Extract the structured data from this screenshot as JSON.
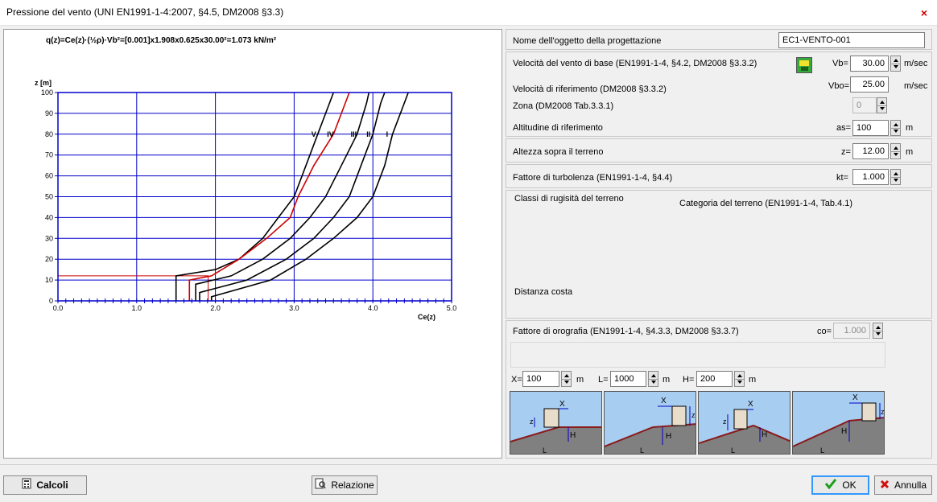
{
  "window": {
    "title": "Pressione del vento (UNI EN1991-1-4:2007, §4.5, DM2008 §3.3)",
    "close_glyph": "×"
  },
  "chart": {
    "formula": "q(z)=Ce(z)·(½ρ)·Vb²=[0.001]x1.908x0.625x30.00²=1.073 kN/m²",
    "y_axis_title": "z [m]",
    "x_axis_title": "Ce(z)"
  },
  "chart_data": {
    "type": "line",
    "xlabel": "Ce(z)",
    "ylabel": "z [m]",
    "xlim": [
      0,
      5
    ],
    "ylim": [
      0,
      100
    ],
    "x_ticks": [
      "0.0",
      "1.0",
      "2.0",
      "3.0",
      "4.0",
      "5.0"
    ],
    "y_ticks": [
      "0",
      "10",
      "20",
      "30",
      "40",
      "50",
      "60",
      "70",
      "80",
      "90",
      "100"
    ],
    "grid": true,
    "curve_labels": [
      "V",
      "IV",
      "III",
      "II",
      "I"
    ],
    "series": [
      {
        "name": "V",
        "color": "#000000",
        "points": [
          [
            1.5,
            0
          ],
          [
            1.5,
            12
          ],
          [
            2.0,
            15
          ],
          [
            2.3,
            20
          ],
          [
            2.6,
            30
          ],
          [
            2.8,
            40
          ],
          [
            3.0,
            50
          ],
          [
            3.15,
            65
          ],
          [
            3.3,
            80
          ],
          [
            3.45,
            95
          ],
          [
            3.5,
            100
          ]
        ]
      },
      {
        "name": "IV",
        "color": "#cc0000",
        "points": [
          [
            1.67,
            0
          ],
          [
            1.67,
            10
          ],
          [
            1.95,
            12
          ],
          [
            2.3,
            20
          ],
          [
            2.65,
            30
          ],
          [
            2.95,
            40
          ],
          [
            3.05,
            50
          ],
          [
            3.25,
            65
          ],
          [
            3.5,
            80
          ],
          [
            3.65,
            95
          ],
          [
            3.7,
            100
          ]
        ]
      },
      {
        "name": "III",
        "color": "#000000",
        "points": [
          [
            1.75,
            0
          ],
          [
            1.75,
            8
          ],
          [
            2.2,
            12
          ],
          [
            2.6,
            20
          ],
          [
            2.95,
            30
          ],
          [
            3.2,
            40
          ],
          [
            3.4,
            50
          ],
          [
            3.6,
            65
          ],
          [
            3.8,
            80
          ],
          [
            3.92,
            95
          ],
          [
            3.95,
            100
          ]
        ]
      },
      {
        "name": "II",
        "color": "#000000",
        "points": [
          [
            1.8,
            0
          ],
          [
            1.8,
            4
          ],
          [
            2.4,
            10
          ],
          [
            2.9,
            20
          ],
          [
            3.25,
            30
          ],
          [
            3.5,
            40
          ],
          [
            3.7,
            50
          ],
          [
            3.85,
            65
          ],
          [
            4.0,
            80
          ],
          [
            4.1,
            95
          ],
          [
            4.15,
            100
          ]
        ]
      },
      {
        "name": "I",
        "color": "#000000",
        "points": [
          [
            1.95,
            0
          ],
          [
            1.95,
            2
          ],
          [
            2.7,
            10
          ],
          [
            3.15,
            20
          ],
          [
            3.5,
            30
          ],
          [
            3.8,
            40
          ],
          [
            4.0,
            50
          ],
          [
            4.15,
            65
          ],
          [
            4.25,
            80
          ],
          [
            4.4,
            95
          ],
          [
            4.45,
            100
          ]
        ]
      }
    ],
    "reference": {
      "z": 12.0,
      "ce": 1.908,
      "color": "#cc0000"
    }
  },
  "form": {
    "object_name": {
      "label": "Nome dell'oggetto della progettazione",
      "value": "EC1-VENTO-001"
    },
    "vb": {
      "label": "Velocità del vento di base (EN1991-1-4, §4.2, DM2008 §3.3.2)",
      "prefix": "Vb=",
      "value": "30.00",
      "unit": "m/sec"
    },
    "vbo": {
      "label": "Velocità di riferimento (DM2008 §3.3.2)",
      "prefix": "Vbo=",
      "value": "25.00",
      "unit": "m/sec"
    },
    "zona": {
      "label": "Zona (DM2008 Tab.3.3.1)",
      "value": "0"
    },
    "altitude": {
      "label": "Altitudine di riferimento",
      "prefix": "as=",
      "value": "100",
      "unit": "m"
    },
    "height": {
      "label": "Altezza sopra il terreno",
      "prefix": "z=",
      "value": "12.00",
      "unit": "m"
    },
    "kt": {
      "label": "Fattore di turbolenza (EN1991-1-4, §4.4)",
      "prefix": "kt=",
      "value": "1.000"
    },
    "roughness": {
      "label": "Classi di rugisità del terreno",
      "category_label": "Categoria del terreno (EN1991-1-4, Tab.4.1)",
      "coast_label": "Distanza costa"
    },
    "orography": {
      "label": "Fattore di orografia (EN1991-1-4, §4.3.3, DM2008 §3.3.7)",
      "prefix": "co=",
      "value": "1.000"
    },
    "x": {
      "prefix": "X=",
      "value": "100",
      "unit": "m"
    },
    "l": {
      "prefix": "L=",
      "value": "1000",
      "unit": "m"
    },
    "h": {
      "prefix": "H=",
      "value": "200",
      "unit": "m"
    }
  },
  "diagram_labels": {
    "x": "X",
    "z": "z",
    "h": "H",
    "l": "L"
  },
  "buttons": {
    "calcoli": "Calcoli",
    "relazione": "Relazione",
    "ok": "OK",
    "annulla": "Annulla"
  },
  "colors": {
    "grid": "#0000cc",
    "ground": "#808080",
    "sky": "#a7cdf0",
    "building": "#e8dccb",
    "ok_border": "#3399ff"
  }
}
